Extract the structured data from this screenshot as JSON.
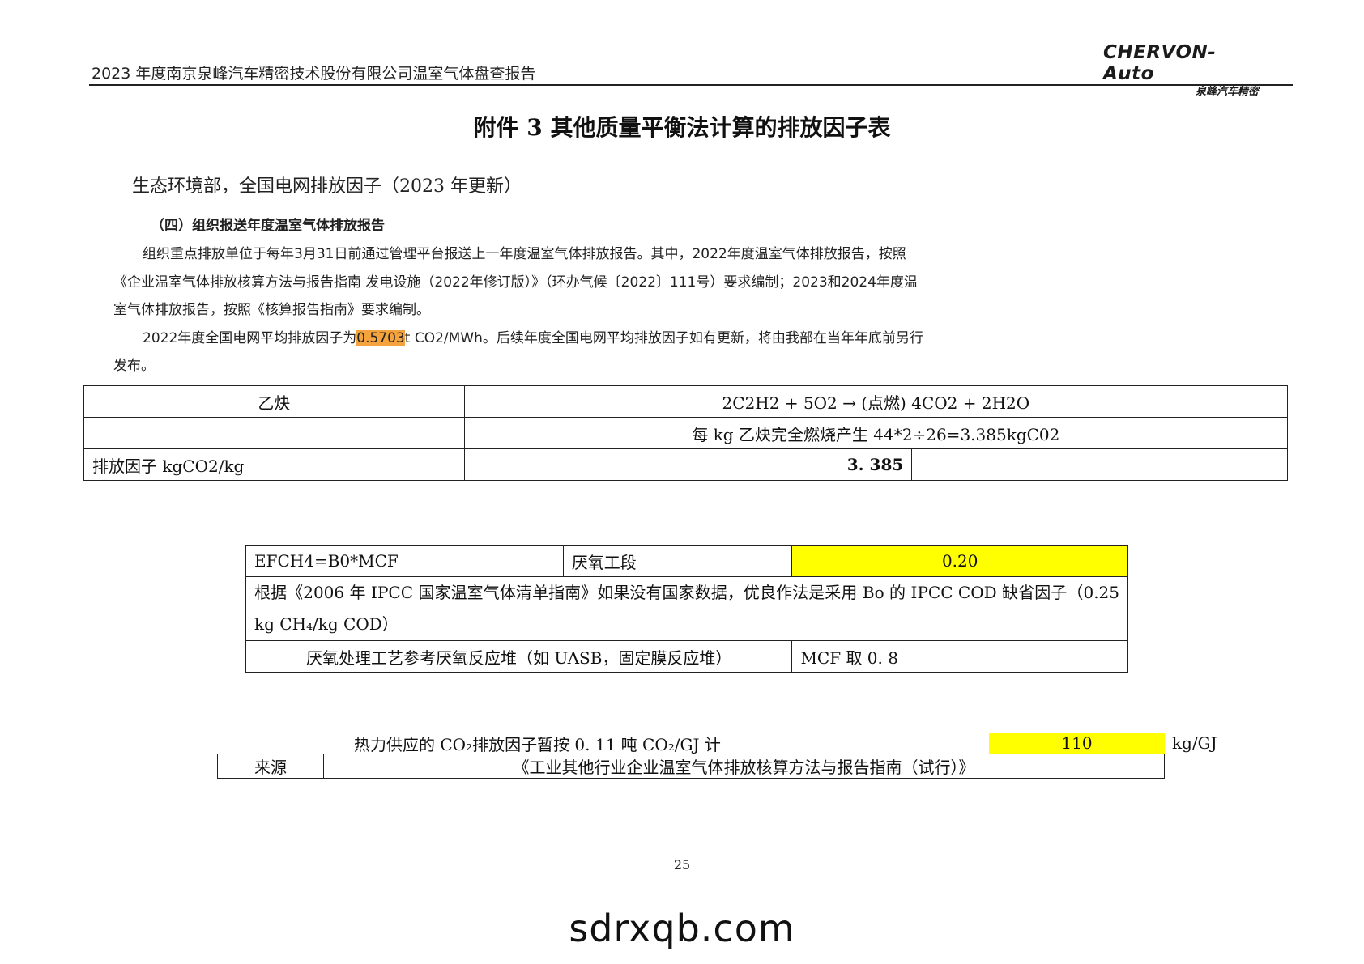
{
  "header": {
    "title": "2023 年度南京泉峰汽车精密技术股份有限公司温室气体盘查报告",
    "logo_main": "CHERVON-Auto",
    "logo_sub": "泉峰汽车精密"
  },
  "page_title": "附件 3 其他质量平衡法计算的排放因子表",
  "source_line": "生态环境部，全国电网排放因子（2023 年更新）",
  "notice": {
    "heading": "（四）组织报送年度温室气体排放报告",
    "para1": "组织重点排放单位于每年3月31日前通过管理平台报送上一年度温室气体排放报告。其中，2022年度温室气体排放报告，按照《企业温室气体排放核算方法与报告指南 发电设施（2022年修订版）》（环办气候〔2022〕111号）要求编制；2023和2024年度温室气体排放报告，按照《核算报告指南》要求编制。",
    "para2_before": "2022年度全国电网平均排放因子为",
    "para2_highlight": "0.5703",
    "para2_after": "t CO2/MWh。后续年度全国电网平均排放因子如有更新，将由我部在当年年底前另行发布。"
  },
  "acetylene_table": {
    "name": "乙炔",
    "equation": "2C2H2 + 5O2 → (点燃) 4CO2 + 2H2O",
    "note": "每 kg 乙炔完全燃烧产生 44*2÷26=3.385kgC02",
    "factor_label": "排放因子 kgCO2/kg",
    "factor_value": "3. 385"
  },
  "ch4_table": {
    "formula": "EFCH4=B0*MCF",
    "stage": "厌氧工段",
    "value": "0.20",
    "basis": "根据《2006 年 IPCC 国家温室气体清单指南》如果没有国家数据，优良作法是采用 Bo 的 IPCC COD 缺省因子（0.25 kg CH₄/kg COD）",
    "process": "厌氧处理工艺参考厌氧反应堆（如 UASB，固定膜反应堆）",
    "mcf": "MCF 取 0. 8"
  },
  "heat": {
    "caption": "热力供应的 CO₂排放因子暂按 0. 11 吨 CO₂/GJ 计",
    "value": "110",
    "unit": "kg/GJ",
    "source_label": "来源",
    "source_text": "《工业其他行业企业温室气体排放核算方法与报告指南（试行）》"
  },
  "page_number": "25",
  "watermark": "sdrxqb.com",
  "colors": {
    "highlight_yellow": "#ffff00",
    "highlight_orange": "#f5a33c"
  }
}
